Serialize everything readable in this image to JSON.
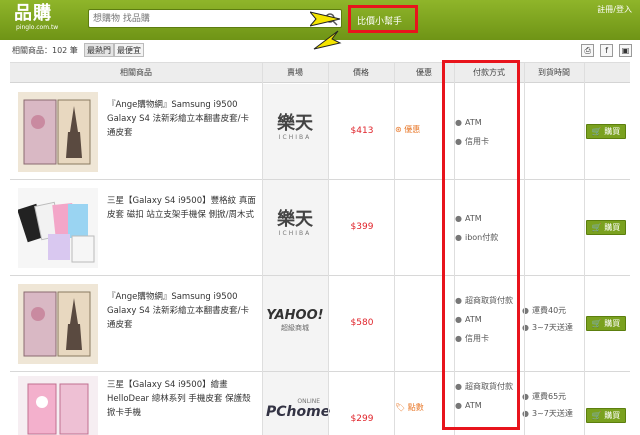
{
  "header": {
    "logo_text": "品購",
    "logo_sub": "pinglo.com.tw",
    "search_placeholder": "想購物 找品購",
    "helper_label": "比價小幫手",
    "top_links": "註冊/登入"
  },
  "toolbar": {
    "count_label": "相關商品：102 筆",
    "sort_hot": "最熱門",
    "sort_cheap": "最便宜",
    "tool_print": "⎙",
    "tool_fb": "f",
    "tool_other": "▣"
  },
  "columns": [
    "相關商品",
    "賣場",
    "價格",
    "優惠",
    "付款方式",
    "到貨時間"
  ],
  "rows": [
    {
      "title": "『Ange購物網』Samsung i9500 Galaxy S4 法新彩繪立本翻書皮套/卡通皮套",
      "store": "樂天",
      "store_sub": "ICHIBA",
      "price": "$413",
      "promo": "優惠",
      "payments": [
        "ATM",
        "信用卡"
      ],
      "shipping": [],
      "buy": "購買"
    },
    {
      "title": "三星【Galaxy S4 i9500】豐格紋 真面皮套 磁扣 站立支架手機保 側掀/周木式",
      "store": "樂天",
      "store_sub": "ICHIBA",
      "price": "$399",
      "promo": "",
      "payments": [
        "ATM",
        "ibon付款"
      ],
      "shipping": [],
      "buy": "購買"
    },
    {
      "title": "『Ange購物網』Samsung i9500 Galaxy S4 法新彩繪立本翻書皮套/卡通皮套",
      "store": "YAHOO!",
      "store_sub": "超級商城",
      "price": "$580",
      "promo": "",
      "payments": [
        "超商取貨付款",
        "ATM",
        "信用卡"
      ],
      "shipping": [
        "運費40元",
        "3~7天送達"
      ],
      "buy": "購買"
    },
    {
      "title": "三星【Galaxy S4 i9500】繪畫 HelloDear 總林系列 手機皮套 保護殼 掀卡手機",
      "store": "PChome",
      "store_sub": "ONLINE",
      "price": "$299",
      "promo": "點數",
      "payments": [
        "超商取貨付款",
        "ATM"
      ],
      "shipping": [
        "運費65元",
        "3~7天送達"
      ],
      "buy": "購買"
    }
  ],
  "colors": {
    "brand_green": "#7aa11f",
    "price_red": "#e0242b",
    "highlight_red": "#e8141c"
  }
}
